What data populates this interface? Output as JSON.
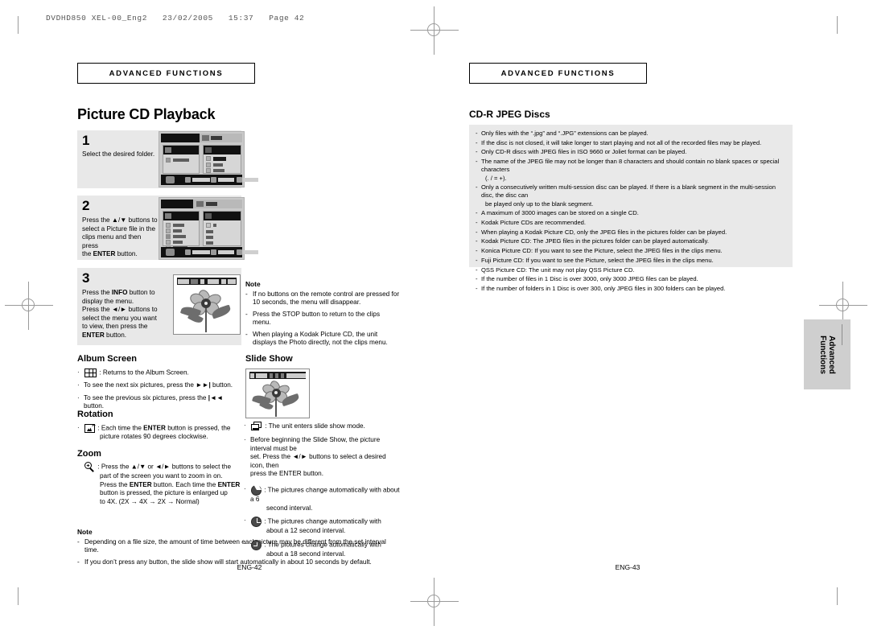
{
  "print": {
    "file_header": "DVDHD850 XEL-00_Eng2   23/02/2005   15:37   Page 42"
  },
  "left_page": {
    "section_label": "Advanced Functions",
    "title": "Picture CD Playback",
    "steps": [
      {
        "number": "1",
        "text": "Select the desired folder."
      },
      {
        "number": "2",
        "text_parts": {
          "l1": "Press the ▲/▼ buttons to",
          "l2": "select a Picture file in the",
          "l3": "clips menu and then press",
          "l4_pre": "the ",
          "l4_b": "ENTER",
          "l4_post": " button."
        }
      },
      {
        "number": "3",
        "text_parts": {
          "l1_pre": "Press the ",
          "l1_b": "INFO",
          "l1_post": " button to",
          "l2": "display the menu.",
          "l3": "Press the ◄/► buttons to",
          "l4": "select the menu you want",
          "l5": "to view, then press the",
          "l6_b": "ENTER",
          "l6_post": " button."
        }
      }
    ],
    "album_screen": {
      "heading": "Album Screen",
      "line_icon_text": ": Returns to the Album Screen.",
      "line2_pre": "To see the next six pictures, press the ",
      "line2_icon": "►►|",
      "line2_post": " button.",
      "line3_pre": "To see the previous six pictures, press the ",
      "line3_icon": "|◄◄",
      "line3_post": " button."
    },
    "rotation": {
      "heading": "Rotation",
      "line1_pre": ": Each time the ",
      "line1_b": "ENTER",
      "line1_post": " button is pressed, the",
      "line2": "picture rotates 90 degrees clockwise."
    },
    "zoom": {
      "heading": "Zoom",
      "l1": ": Press the ▲/▼ or ◄/► buttons to select the",
      "l2": "part of the screen you want to zoom in on.",
      "l3_pre": "Press the ",
      "l3_b1": "ENTER",
      "l3_mid": " button. Each time the ",
      "l3_b2": "ENTER",
      "l4": "button is pressed, the picture is enlarged up",
      "l5": "to 4X. (2X → 4X → 2X → Normal)"
    },
    "bottom_note": {
      "title": "Note",
      "items": [
        "Depending on a file size, the amount of time between each picture may be different from the set interval time.",
        "If you don’t press any button, the slide show will start automatically in about 10 seconds by default."
      ]
    },
    "page_number": "ENG-42"
  },
  "middle_column": {
    "note": {
      "title": "Note",
      "items": [
        "If no buttons on the remote control are pressed for 10 seconds, the menu will disappear.",
        "Press the STOP button to return to the clips menu.",
        "When playing a Kodak Picture CD, the unit displays the Photo directly, not the clips menu."
      ]
    },
    "slide_show": {
      "heading": "Slide Show",
      "icon_line": ": The unit enters slide show mode.",
      "intro_l1": "Before beginning the Slide Show, the picture interval must be",
      "intro_l2": "set. Press the ◄/► buttons to select a desired icon, then",
      "intro_l3": "press the ENTER button.",
      "intervals": [
        {
          "l1": ": The pictures change automatically with about a 6",
          "l2": "second interval."
        },
        {
          "l1": ": The pictures change automatically with",
          "l2": "about a 12 second interval."
        },
        {
          "l1": ": The pictures change automatically with",
          "l2": "about a 18 second interval."
        }
      ]
    }
  },
  "right_page": {
    "section_label": "Advanced Functions",
    "title": "CD-R JPEG Discs",
    "bullets": [
      "Only files with the “.jpg” and “.JPG” extensions can be played.",
      "If the disc is not closed, it will take longer to start playing and not all of the recorded files may be played.",
      "Only CD-R discs with JPEG files in ISO 9660 or Joliet format can be played.",
      "The name of the JPEG file may not be longer than 8 characters and should contain no blank spaces or special characters",
      "Only a consecutively written multi-session disc can be played. If there is a blank segment in the multi-session disc, the disc can",
      "A maximum of 3000 images can be stored on a single CD.",
      "Kodak Picture CDs are recommended.",
      "When playing a Kodak Picture CD, only the JPEG files in the pictures folder can be played.",
      "Kodak Picture CD: The JPEG files in the pictures folder can be played automatically.",
      "Konica Picture CD: If you want to see the Picture, select the JPEG files in the clips menu.",
      "Fuji Picture CD: If you want to see the Picture, select the JPEG files in the clips menu.",
      "QSS Picture CD: The unit may not play QSS Picture CD.",
      "If the number of files in 1 Disc is over 3000, only 3000 JPEG files can be played.",
      "If the number of folders in 1 Disc is over 300, only JPEG files in 300 folders can be played."
    ],
    "continuation_4": "(. / = +).",
    "continuation_5": "be played only up to the blank segment.",
    "side_tab_line1": "Advanced",
    "side_tab_line2": "Functions",
    "page_number": "ENG-43"
  }
}
